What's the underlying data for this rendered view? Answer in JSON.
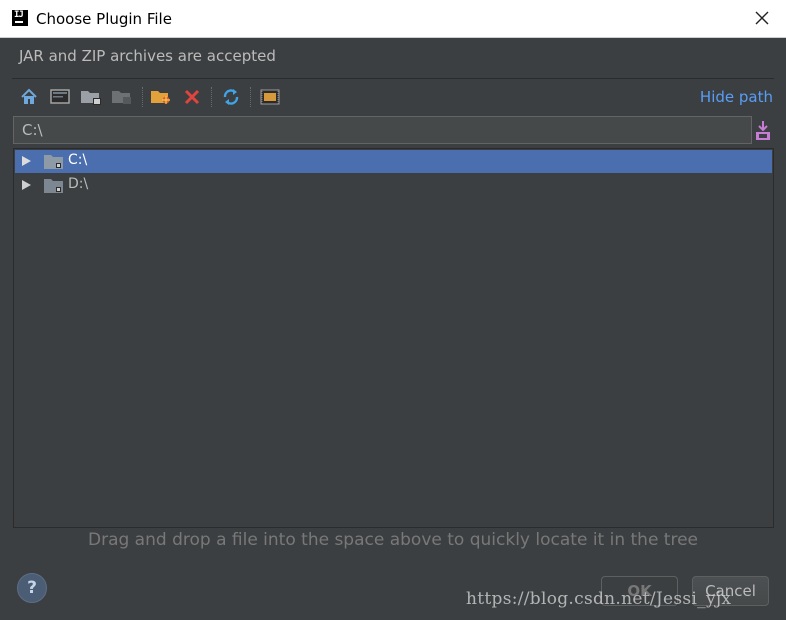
{
  "window": {
    "title": "Choose Plugin File",
    "logo_text": "IJ"
  },
  "subtitle": "JAR and ZIP archives are accepted",
  "toolbar": {
    "icons": [
      "home-icon",
      "desktop-icon",
      "project-folder-icon",
      "module-folder-icon",
      "new-folder-icon",
      "delete-icon",
      "refresh-icon",
      "show-hidden-icon"
    ],
    "hide_path_label": "Hide path"
  },
  "path_field": {
    "value": "C:\\"
  },
  "tree": {
    "items": [
      {
        "label": "C:\\",
        "selected": true
      },
      {
        "label": "D:\\",
        "selected": false
      }
    ]
  },
  "hint": "Drag and drop a file into the space above to quickly locate it in the tree",
  "buttons": {
    "help_label": "?",
    "ok_label": "OK",
    "cancel_label": "Cancel"
  },
  "watermark": "https://blog.csdn.net/Jessi_yjx",
  "colors": {
    "background": "#3c3f41",
    "selection": "#4b6eaf",
    "link": "#589df6",
    "text": "#bbbbbb"
  }
}
